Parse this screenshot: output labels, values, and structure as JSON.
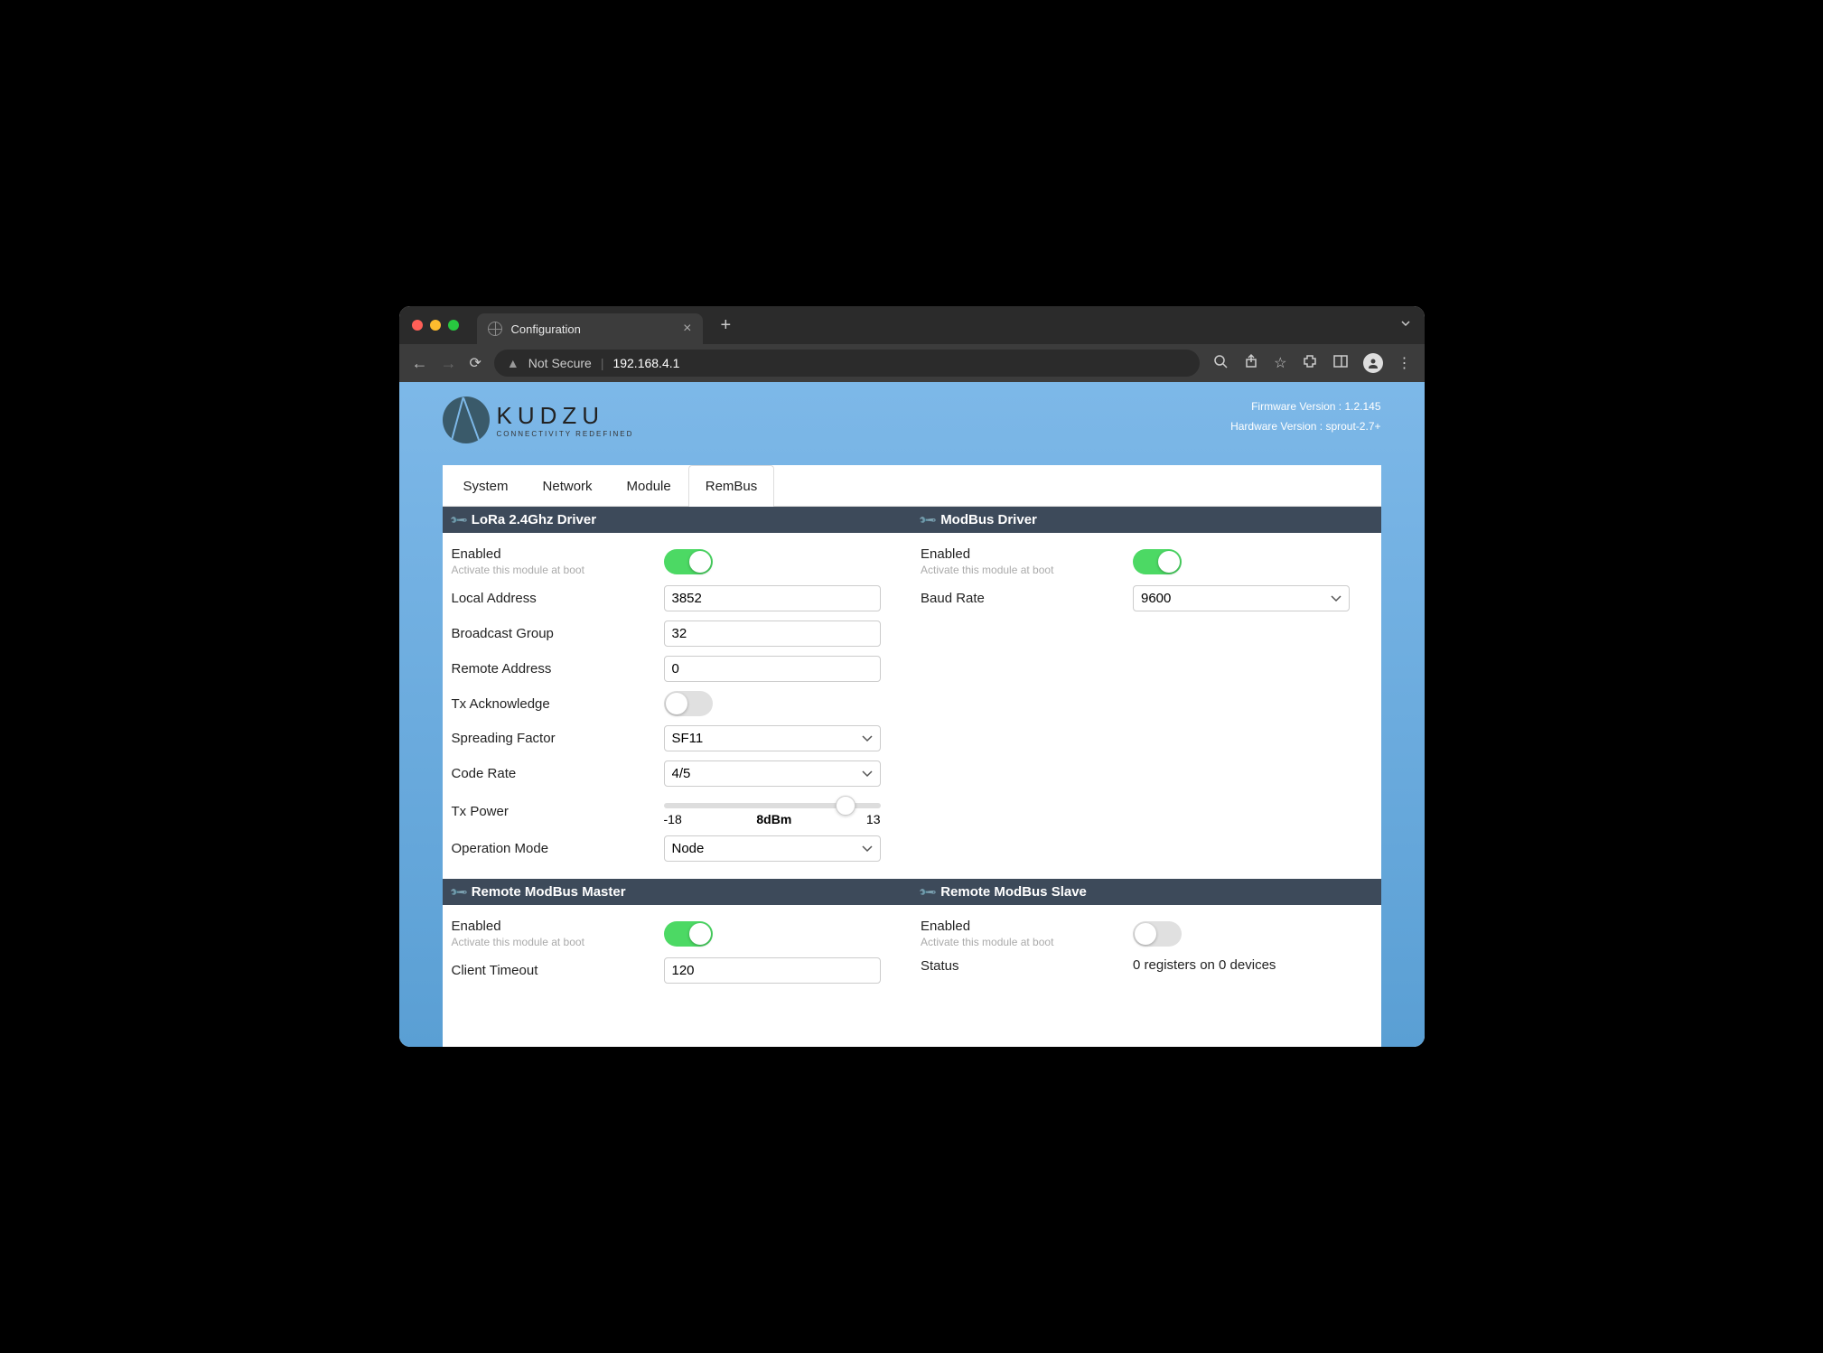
{
  "browser": {
    "tab_title": "Configuration",
    "not_secure_label": "Not Secure",
    "url": "192.168.4.1"
  },
  "header": {
    "logo_name": "KUDZU",
    "logo_tagline": "CONNECTIVITY REDEFINED",
    "firmware_label": "Firmware Version : 1.2.145",
    "hardware_label": "Hardware Version : sprout-2.7+"
  },
  "tabs": {
    "system": "System",
    "network": "Network",
    "module": "Module",
    "rembus": "RemBus"
  },
  "lora": {
    "title": "LoRa 2.4Ghz Driver",
    "enabled_label": "Enabled",
    "enabled_sub": "Activate this module at boot",
    "local_address_label": "Local Address",
    "local_address_value": "3852",
    "broadcast_group_label": "Broadcast Group",
    "broadcast_group_value": "32",
    "remote_address_label": "Remote Address",
    "remote_address_value": "0",
    "tx_ack_label": "Tx Acknowledge",
    "spreading_factor_label": "Spreading Factor",
    "spreading_factor_value": "SF11",
    "code_rate_label": "Code Rate",
    "code_rate_value": "4/5",
    "tx_power_label": "Tx Power",
    "tx_power_min": "-18",
    "tx_power_current": "8dBm",
    "tx_power_max": "13",
    "tx_power_percent": 84,
    "op_mode_label": "Operation Mode",
    "op_mode_value": "Node"
  },
  "modbus": {
    "title": "ModBus Driver",
    "enabled_label": "Enabled",
    "enabled_sub": "Activate this module at boot",
    "baud_label": "Baud Rate",
    "baud_value": "9600"
  },
  "remote_master": {
    "title": "Remote ModBus Master",
    "enabled_label": "Enabled",
    "enabled_sub": "Activate this module at boot",
    "client_timeout_label": "Client Timeout",
    "client_timeout_value": "120"
  },
  "remote_slave": {
    "title": "Remote ModBus Slave",
    "enabled_label": "Enabled",
    "enabled_sub": "Activate this module at boot",
    "status_label": "Status",
    "status_value": "0 registers on 0 devices"
  }
}
